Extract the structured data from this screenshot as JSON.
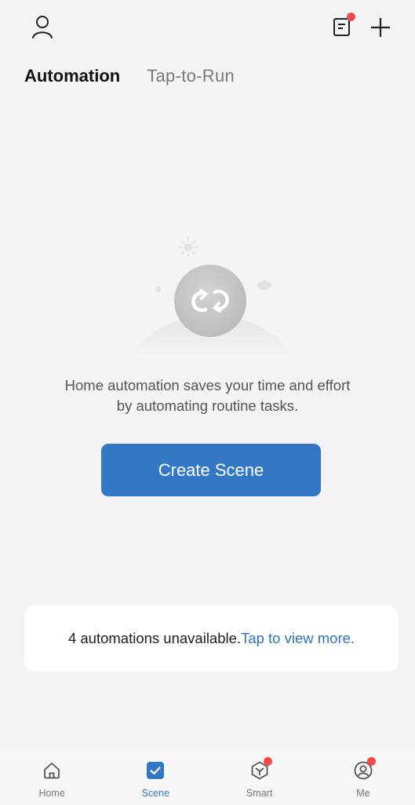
{
  "header": {
    "icons": [
      "profile-icon",
      "notes-icon",
      "plus-icon"
    ]
  },
  "tabs": [
    {
      "label": "Automation",
      "active": true
    },
    {
      "label": "Tap-to-Run",
      "active": false
    }
  ],
  "empty_state": {
    "message_line1": "Home automation saves your time and effort",
    "message_line2": "by automating routine tasks.",
    "button_label": "Create Scene"
  },
  "notice": {
    "text": "4 automations unavailable.",
    "link": "Tap to view more."
  },
  "bottom_nav": [
    {
      "label": "Home",
      "icon": "home-icon",
      "active": false
    },
    {
      "label": "Scene",
      "icon": "scene-check-icon",
      "active": true
    },
    {
      "label": "Smart",
      "icon": "smart-icon",
      "active": false
    },
    {
      "label": "Me",
      "icon": "me-icon",
      "active": false
    }
  ],
  "colors": {
    "accent": "#3378c4",
    "background": "#f4f4f6",
    "badge": "#f04a4a"
  }
}
